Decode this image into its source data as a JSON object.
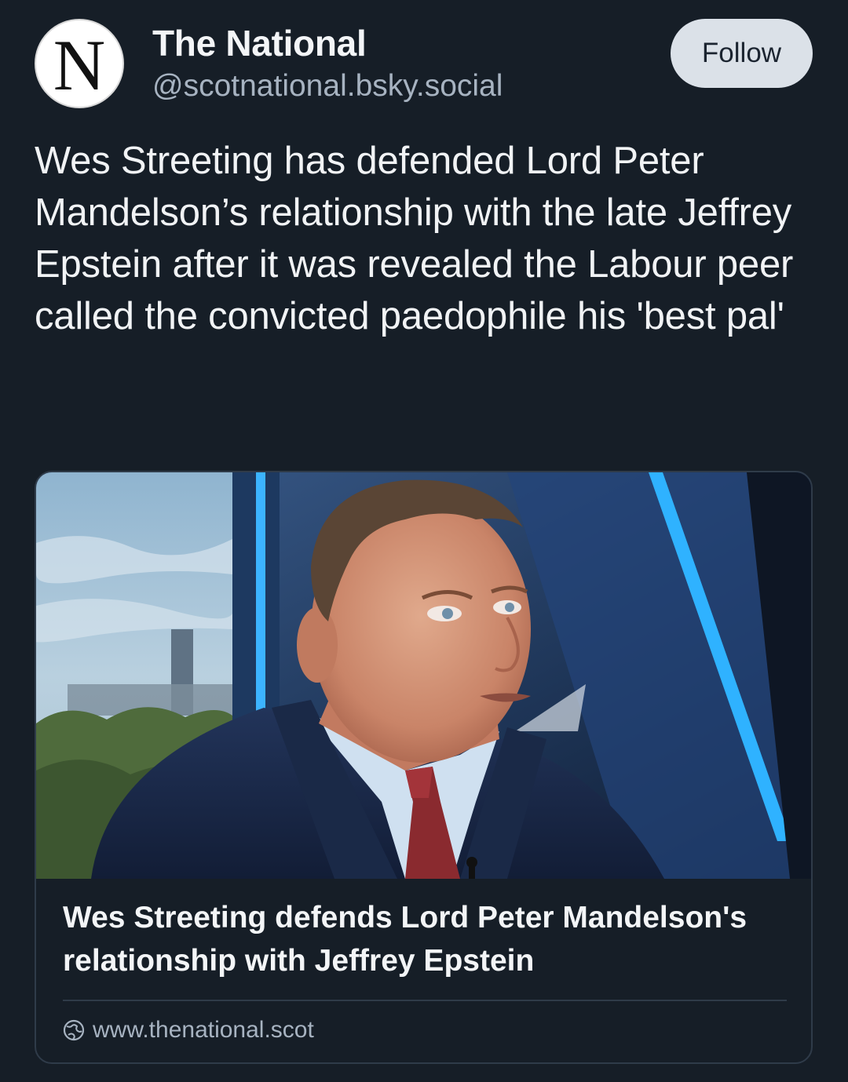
{
  "author": {
    "avatar_letter": "N",
    "display_name": "The National",
    "handle": "@scotnational.bsky.social",
    "follow_label": "Follow"
  },
  "post": {
    "text": "Wes Streeting has defended Lord Peter Mandelson’s relationship with the late Jeffrey Epstein after it was revealed the Labour peer called the convicted paedophile his 'best pal'"
  },
  "link_card": {
    "image_alt": "News photo of a man in a suit and red tie in a TV studio",
    "title": "Wes Streeting defends Lord Peter Mandelson's relationship with Jeffrey Epstein",
    "domain": "www.thenational.scot",
    "domain_icon": "globe-icon"
  },
  "colors": {
    "background": "#161e27",
    "text_primary": "#f1f3f5",
    "text_secondary": "#a7b3c1",
    "follow_button_bg": "#dbe1e8",
    "card_border": "#2f3b49"
  }
}
